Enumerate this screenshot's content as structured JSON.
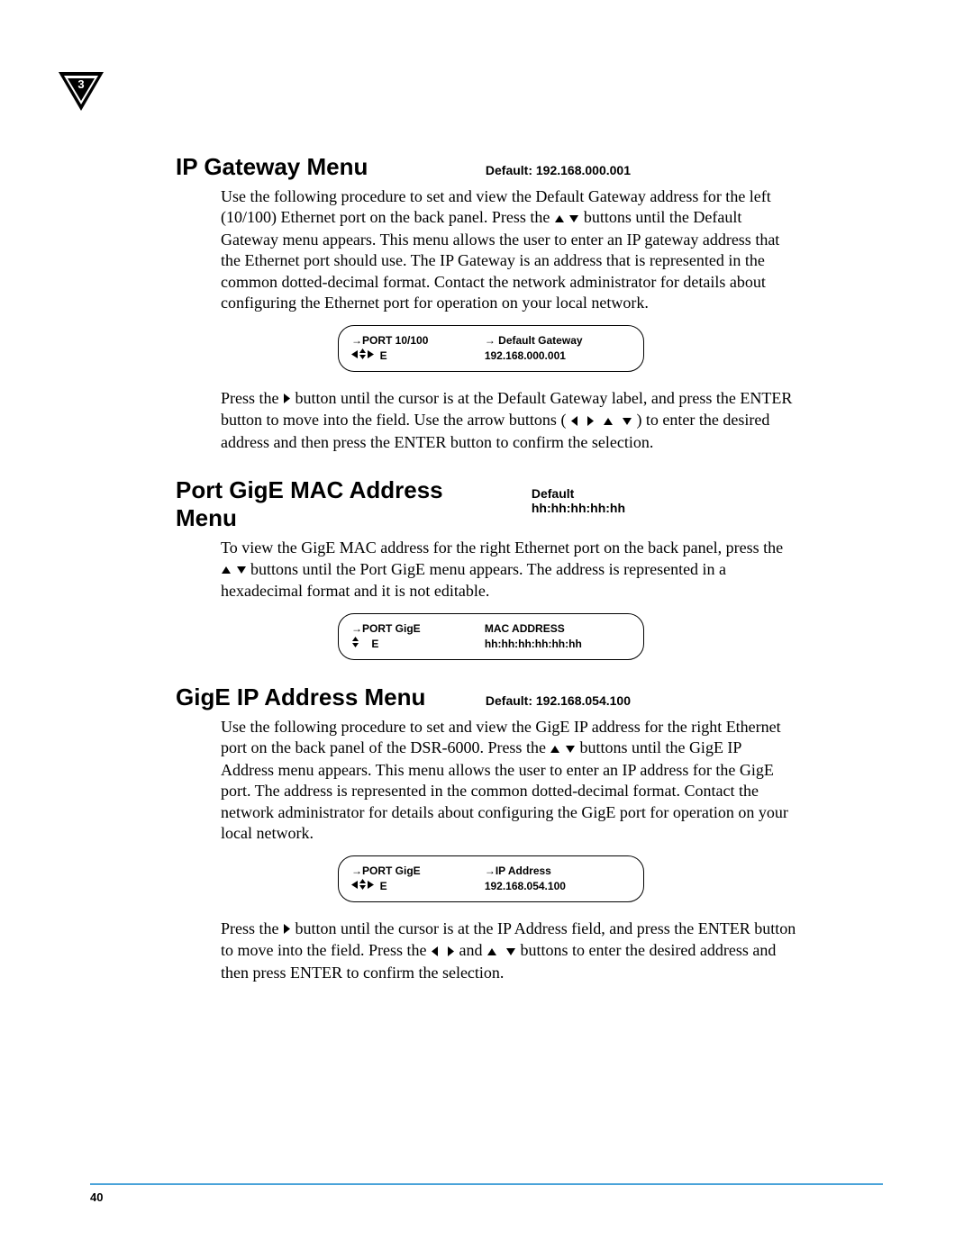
{
  "chapter_number": "3",
  "page_number": "40",
  "sections": [
    {
      "title": "IP Gateway Menu",
      "default_label": "Default: 192.168.000.001",
      "para1_a": "Use the following procedure to set and view the Default Gateway address for the left (10/100) Ethernet port on the back panel. Press the ",
      "para1_b": " buttons until the Default Gateway menu appears. This menu allows the user to enter an IP gateway address that the Ethernet port should use. The IP Gateway is an address that is represented in the common dotted-decimal format. Contact the network administrator for details about configuring the Ethernet port for operation on your local network.",
      "lcd": {
        "r1c1": "PORT 10/100",
        "r1c2": "Default Gateway",
        "r2c1": "E",
        "r2c2": "192.168.000.001"
      },
      "para2_a": "Press the ",
      "para2_b": " button until the cursor is at the Default Gateway label, and press the ENTER button to move into the field. Use the arrow buttons ( ",
      "para2_c": " ) to enter the desired address and then press the ENTER button to confirm the selection."
    },
    {
      "title": "Port GigE MAC Address Menu",
      "default_label": "Default hh:hh:hh:hh:hh",
      "para1_a": "To view the GigE MAC address for the right Ethernet port on the back panel, press the ",
      "para1_b": " buttons until the Port GigE menu appears. The address is represented in a hexadecimal format and it is not editable.",
      "lcd": {
        "r1c1": "PORT GigE",
        "r1c2": "MAC ADDRESS",
        "r2c1": "E",
        "r2c2": "hh:hh:hh:hh:hh:hh"
      }
    },
    {
      "title": "GigE IP Address Menu",
      "default_label": "Default: 192.168.054.100",
      "para1_a": "Use the following procedure to set and view the GigE IP address for the right Ethernet port on the back panel of the DSR-6000. Press the ",
      "para1_b": " buttons until the GigE IP Address menu appears. This menu allows the user to enter an IP address for the GigE port. The address is represented in the common dotted-decimal format. Contact the network administrator for details about configuring the GigE port for operation on your local network.",
      "lcd": {
        "r1c1": "PORT GigE",
        "r1c2": "IP Address",
        "r2c1": "E",
        "r2c2": "192.168.054.100"
      },
      "para2_a": "Press the ",
      "para2_b": " button until the cursor is at the IP Address field, and press the ENTER button to move into the field. Press the ",
      "para2_c": " and ",
      "para2_d": " buttons to enter the desired address and then press ENTER to confirm the selection."
    }
  ]
}
